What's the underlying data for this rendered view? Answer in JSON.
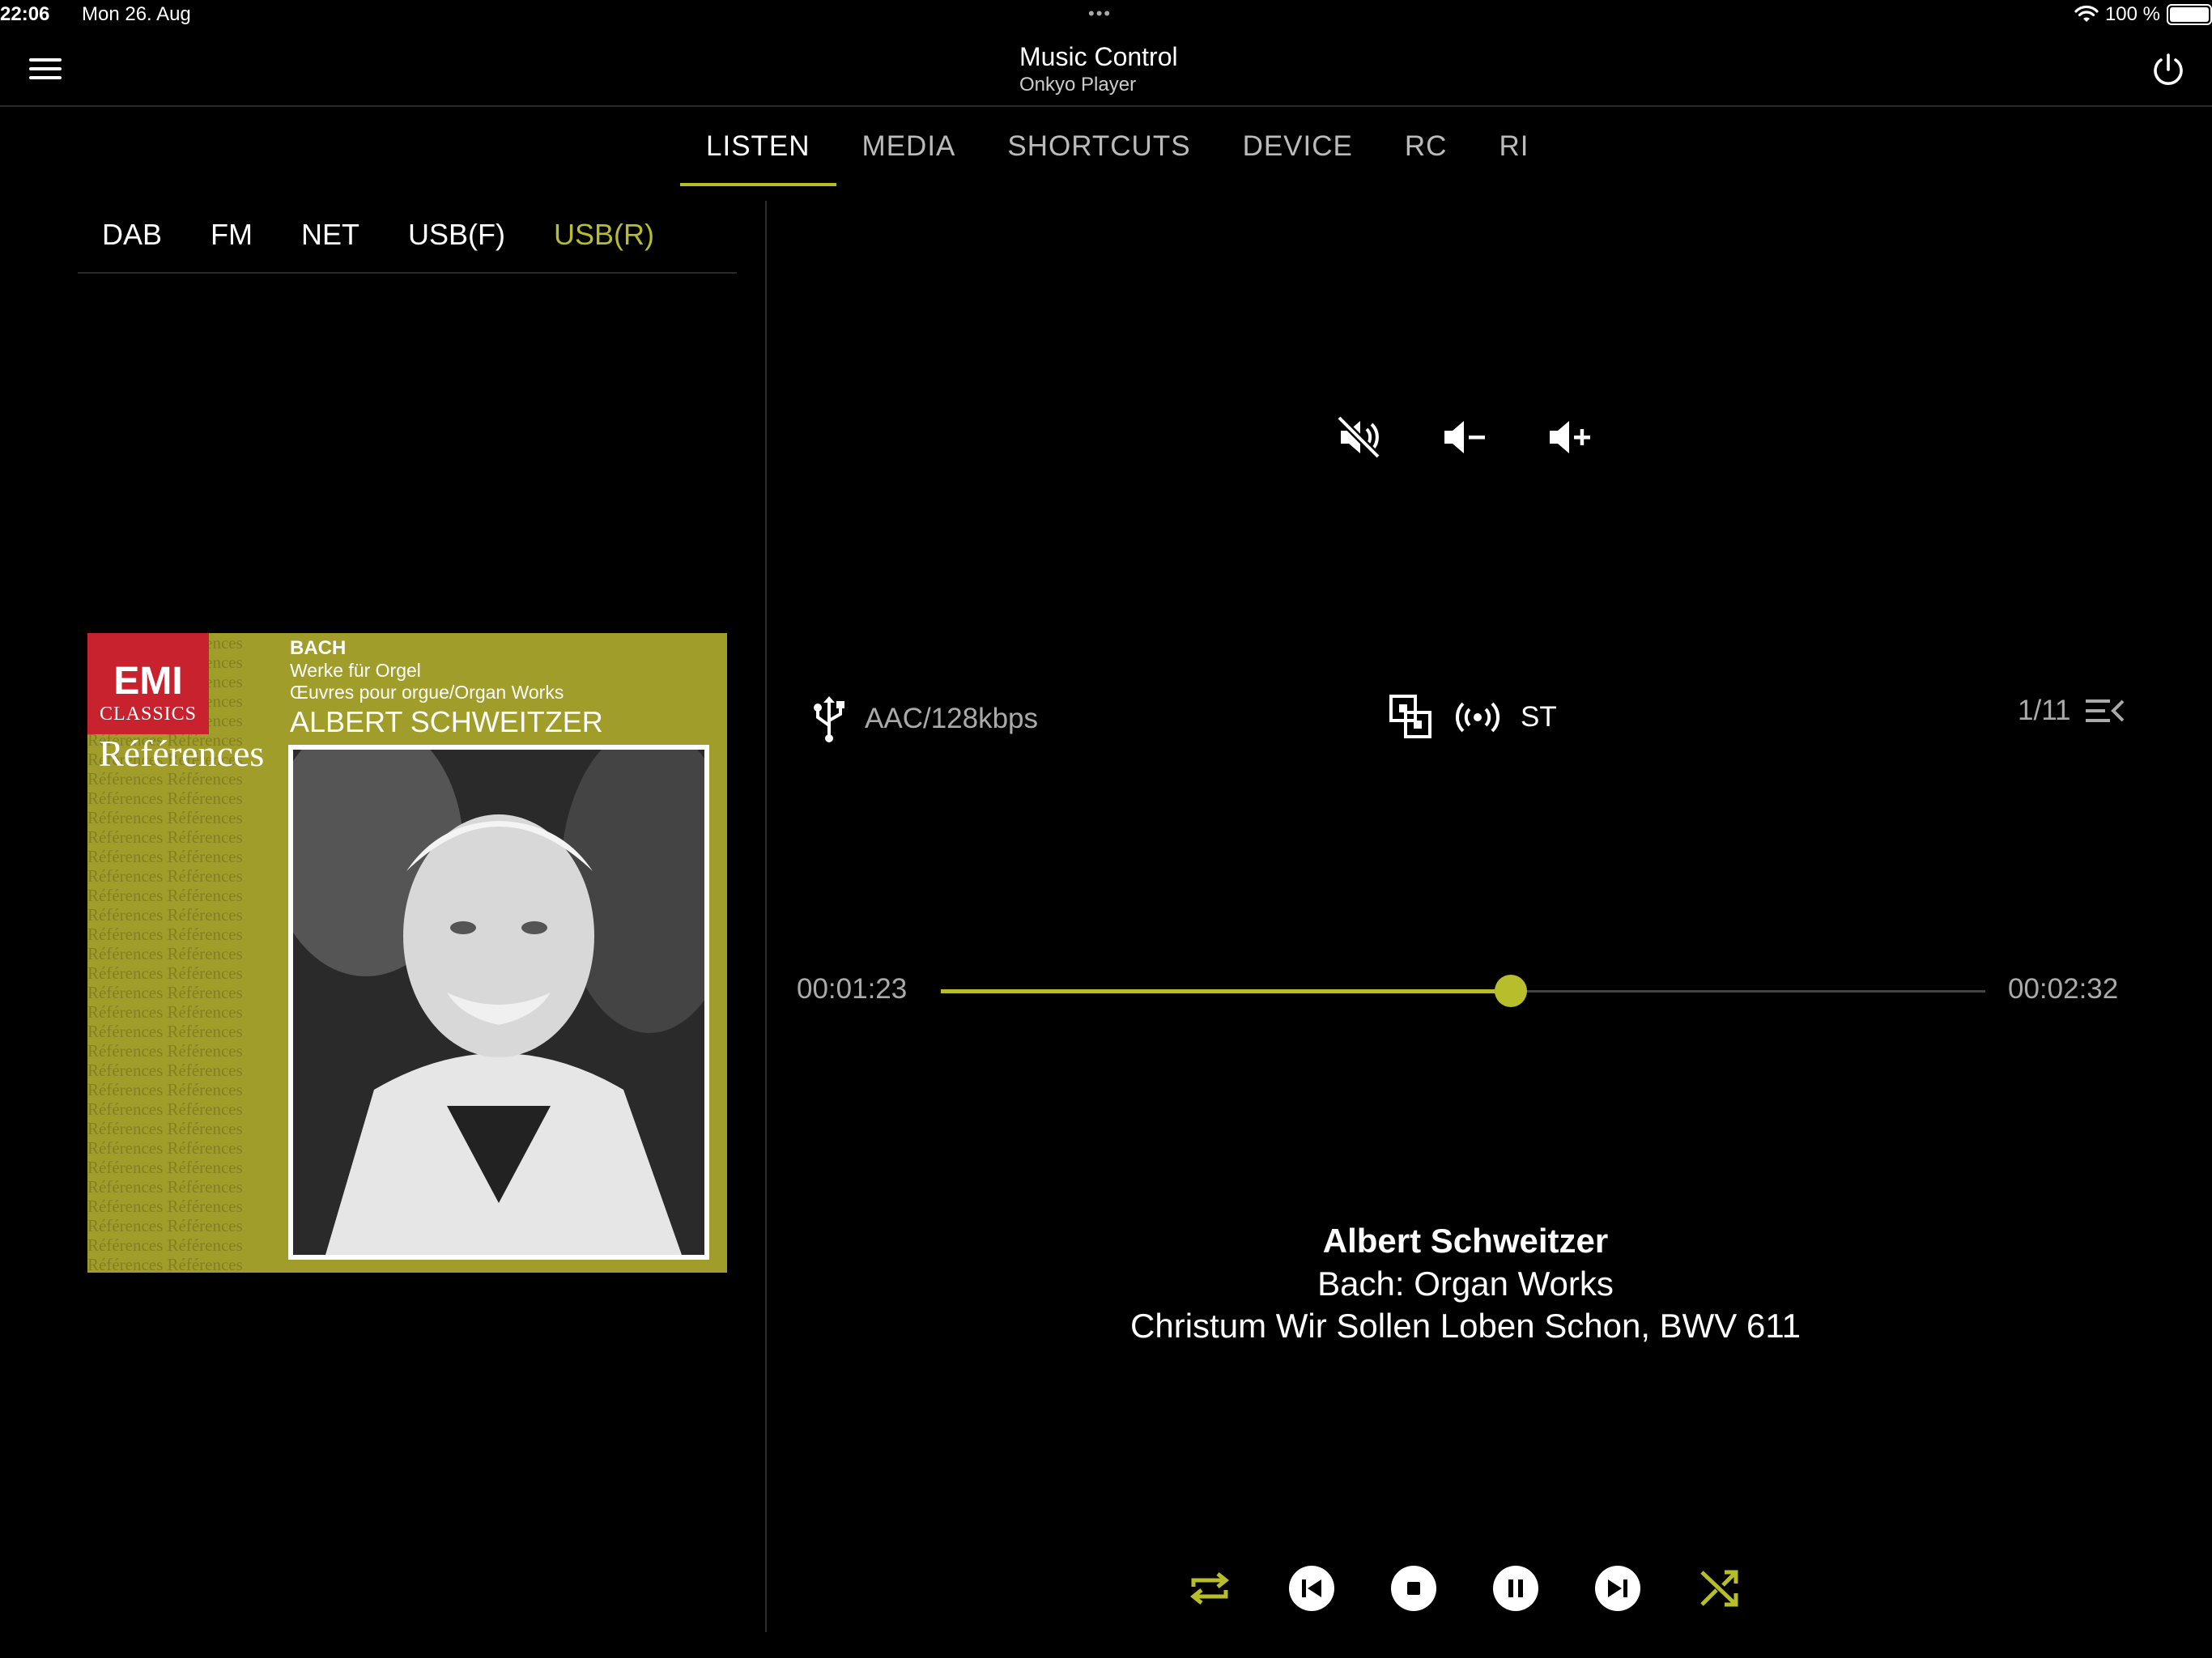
{
  "status_bar": {
    "time": "22:06",
    "date": "Mon 26. Aug",
    "dots": "•••",
    "battery": "100 %"
  },
  "header": {
    "title": "Music Control",
    "subtitle": "Onkyo Player"
  },
  "tabs": [
    {
      "label": "LISTEN",
      "active": true
    },
    {
      "label": "MEDIA"
    },
    {
      "label": "SHORTCUTS"
    },
    {
      "label": "DEVICE"
    },
    {
      "label": "RC"
    },
    {
      "label": "RI"
    }
  ],
  "sources": [
    {
      "label": "DAB"
    },
    {
      "label": "FM"
    },
    {
      "label": "NET"
    },
    {
      "label": "USB(F)"
    },
    {
      "label": "USB(R)",
      "active": true
    }
  ],
  "album_art": {
    "logo": "EMI",
    "classics": "CLASSICS",
    "series": "Références",
    "line1": "BACH",
    "line2": "Werke für Orgel",
    "line3": "Œuvres pour orgue/Organ Works",
    "line4": "ALBERT SCHWEITZER"
  },
  "info": {
    "format": "AAC/128kbps",
    "stereo": "ST",
    "track_position": "1/11"
  },
  "progress": {
    "elapsed": "00:01:23",
    "total": "00:02:32",
    "fraction": 0.546
  },
  "song": {
    "artist": "Albert Schweitzer",
    "album": "Bach: Organ Works",
    "title": "Christum Wir Sollen Loben Schon, BWV 611"
  },
  "colors": {
    "accent": "#b7bd2b",
    "background": "#000000"
  },
  "icons": [
    "menu-icon",
    "power-icon",
    "mute-icon",
    "volume-down-icon",
    "volume-up-icon",
    "usb-icon",
    "dsp-icon",
    "radio-signal-icon",
    "queue-icon",
    "repeat-icon",
    "previous-icon",
    "stop-icon",
    "pause-icon",
    "next-icon",
    "shuffle-icon",
    "wifi-icon",
    "battery-icon"
  ]
}
